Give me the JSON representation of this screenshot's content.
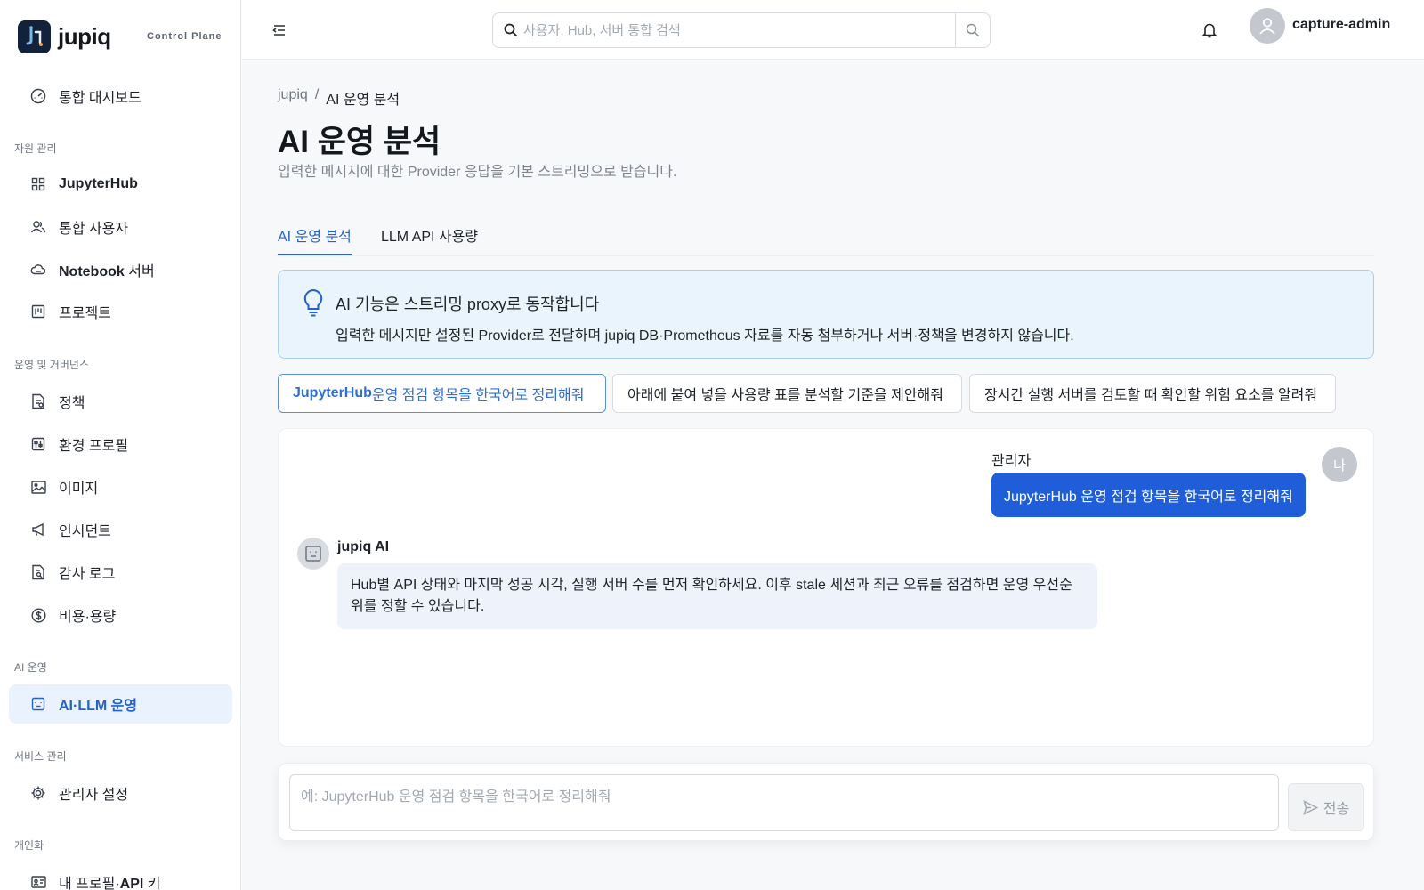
{
  "brand": {
    "name": "jupiq",
    "subtitle": "Control Plane"
  },
  "sidebar": {
    "dashboard": "통합 대시보드",
    "sections": {
      "resources": "자원 관리",
      "governance": "운영 및 거버넌스",
      "ai": "AI 운영",
      "service": "서비스 관리",
      "personal": "개인화"
    },
    "items": {
      "jupyterhub": "JupyterHub",
      "users": "통합 사용자",
      "notebook_bold": "Notebook",
      "notebook_rest": " 서버",
      "projects": "프로젝트",
      "policy": "정책",
      "env_profile": "환경 프로필",
      "images": "이미지",
      "incidents": "인시던트",
      "audit_log": "감사 로그",
      "cost": "비용·용량",
      "ai_llm_bold": "AI·LLM",
      "ai_llm_rest": " 운영",
      "admin_settings": "관리자 설정",
      "profile_a": "내 프로필·",
      "profile_b": "API",
      "profile_c": " 키"
    }
  },
  "header": {
    "search_placeholder": "사용자, Hub, 서버 통합 검색",
    "username": "capture-admin"
  },
  "breadcrumb": {
    "root": "jupiq",
    "separator": "/",
    "current": "AI 운영 분석"
  },
  "page": {
    "title_bold": "AI",
    "title_rest": " 운영 분석",
    "subtitle": "입력한 메시지에 대한 Provider 응답을 기본 스트리밍으로 받습니다."
  },
  "tabs": {
    "analysis": "AI 운영 분석",
    "usage": "LLM API 사용량"
  },
  "notice": {
    "title": "AI 기능은 스트리밍 proxy로 동작합니다",
    "body": "입력한 메시지만 설정된 Provider로 전달하며 jupiq DB·Prometheus 자료를 자동 첨부하거나 서버·정책을 변경하지 않습니다."
  },
  "suggestions": {
    "s1_bold": "JupyterHub",
    "s1_rest": " 운영 점검 항목을 한국어로 정리해줘",
    "s2": "아래에 붙여 넣을 사용량 표를 분석할 기준을 제안해줘",
    "s3": "장시간 실행 서버를 검토할 때 확인할 위험 요소를 알려줘"
  },
  "chat": {
    "user_name": "관리자",
    "user_avatar": "나",
    "user_message": "JupyterHub 운영 점검 항목을 한국어로 정리해줘",
    "ai_name": "jupiq AI",
    "ai_message": "Hub별 API 상태와 마지막 성공 시각, 실행 서버 수를 먼저 확인하세요. 이후 stale 세션과 최근 오류를 점검하면 운영 우선순위를 정할 수 있습니다."
  },
  "composer": {
    "placeholder": "예: JupyterHub 운영 점검 항목을 한국어로 정리해줘",
    "send_label": "전송"
  },
  "colors": {
    "accent": "#2563c9",
    "user_bubble": "#1f5ed8",
    "notice_bg": "#eaf4fc",
    "active_nav_bg": "#eaf2fd"
  },
  "icons": {
    "brand": "jupiq-logo-icon",
    "dashboard": "gauge-icon",
    "jupyterhub": "grid-icon",
    "users": "users-icon",
    "notebook": "cloud-icon",
    "projects": "kanban-icon",
    "policy": "policy-doc-icon",
    "env_profile": "sliders-icon",
    "images": "image-icon",
    "incidents": "megaphone-icon",
    "audit_log": "audit-doc-icon",
    "cost": "dollar-circle-icon",
    "ai_llm": "robot-icon",
    "admin_settings": "gear-icon",
    "profile": "id-card-icon",
    "menu": "menu-collapse-icon",
    "search": "search-icon",
    "bell": "bell-icon",
    "avatar": "user-icon",
    "bulb": "lightbulb-icon",
    "send": "send-icon"
  }
}
